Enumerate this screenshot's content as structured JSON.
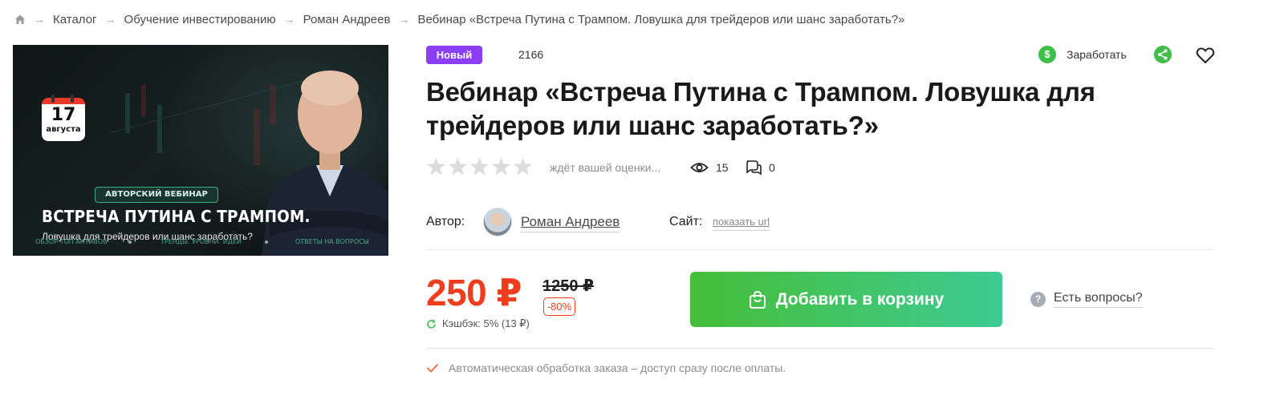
{
  "breadcrumb": {
    "items": [
      "Каталог",
      "Обучение инвестированию",
      "Роман Андреев",
      "Вебинар «Встреча Путина с Трампом. Ловушка для трейдеров или шанс заработать?»"
    ]
  },
  "banner": {
    "calendar_day": "17",
    "calendar_month": "августа",
    "tag": "АВТОРСКИЙ ВЕБИНАР",
    "headline": "ВСТРЕЧА ПУТИНА С ТРАМПОМ.",
    "subline": "Ловушка для трейдеров или шанс заработать?",
    "footer_items": [
      "ОБЗОР ТОП АКТИВОВ",
      "ТРЕНДЫ. УРОВНИ. ИДЕИ",
      "ОТВЕТЫ НА ВОПРОСЫ"
    ]
  },
  "product": {
    "badge": "Новый",
    "id": "2166",
    "title": "Вебинар «Встреча Путина с Трампом. Ловушка для трейдеров или шанс заработать?»",
    "rating": 0,
    "rating_hint": "ждёт вашей оценки...",
    "views": "15",
    "comments": "0",
    "author_label": "Автор:",
    "author_name": "Роман Андреев",
    "site_label": "Сайт:",
    "site_link": "показать url",
    "price": "250 ₽",
    "old_price": "1250 ₽",
    "discount": "-80%",
    "cashback": "Кэшбэк: 5% (13 ₽)",
    "add_to_cart": "Добавить в корзину",
    "questions": "Есть вопросы?",
    "auto_note": "Автоматическая обработка заказа – доступ сразу после оплаты."
  },
  "actions": {
    "earn_label": "Заработать",
    "earn_icon": "$"
  },
  "colors": {
    "accent_green": "#3fbf4a",
    "price_red": "#ef3d1d",
    "badge_purple": "#8b3ff5"
  }
}
